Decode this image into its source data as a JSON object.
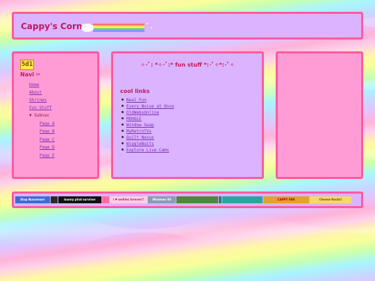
{
  "site": {
    "title": "Cappy's Corner"
  },
  "sidebar": {
    "badge": "5d1",
    "heading": "Navi ✂",
    "links": [
      "Home",
      "About",
      "Shrines",
      "Fun Stuff"
    ],
    "subnav_label": "▼ Subnav",
    "subpages": [
      "Page A",
      "Page B",
      "Page C",
      "Page D",
      "Page E"
    ]
  },
  "main": {
    "title": "✧･ﾟ: *✧･ﾟ:* fun stuff *:･ﾟ✧*:･ﾟ✧",
    "links_heading": "cool links",
    "links": [
      "Neal Fun",
      "Every Noise at Once",
      "OldWebsOnline",
      "MOHOLE",
      "Window Swap",
      "MyRetroTVs",
      "Quilt Nexus",
      "WiggleBaits",
      "Explore Live Cams"
    ]
  },
  "footer": {
    "buttons": [
      {
        "label": "Stop Nunsense!",
        "bg": "#3b6bd6",
        "fg": "#ffffff"
      },
      {
        "label": "",
        "bg": "#2a2a2a",
        "fg": "#ffffff"
      },
      {
        "label": "bunny ptsd survivor",
        "bg": "#111111",
        "fg": "#ffffff"
      },
      {
        "label": "",
        "bg": "#ff6aa0",
        "fg": "#ffffff"
      },
      {
        "label": "i ♥ wellies forever!!",
        "bg": "#ffd0e6",
        "fg": "#c2185b"
      },
      {
        "label": "Windows 95",
        "bg": "#8a9bb5",
        "fg": "#ffffff"
      },
      {
        "label": "",
        "bg": "#4a8a3a",
        "fg": "#ffffff"
      },
      {
        "label": "",
        "bg": "#1f7f7a",
        "fg": "#ffffff"
      },
      {
        "label": "",
        "bg": "#2aa6a0",
        "fg": "#ffffff"
      },
      {
        "label": "CAPPY FAN",
        "bg": "#e0a526",
        "fg": "#b00000"
      },
      {
        "label": "Cheese Rocks!",
        "bg": "#f5d86a",
        "fg": "#7a4b00"
      }
    ]
  }
}
